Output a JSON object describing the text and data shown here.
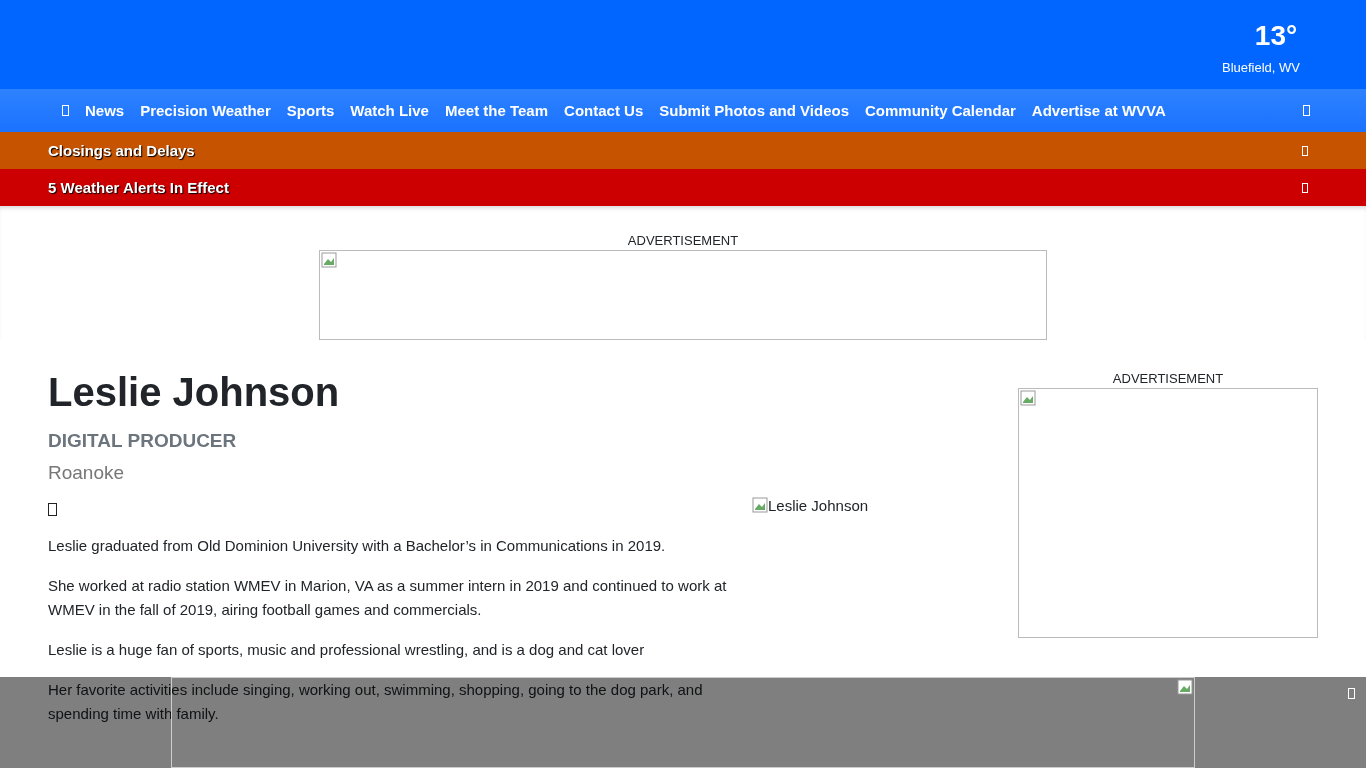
{
  "weather": {
    "temperature": "13°",
    "location": "Bluefield, WV"
  },
  "nav": {
    "items": [
      "News",
      "Precision Weather",
      "Sports",
      "Watch Live",
      "Meet the Team",
      "Contact Us",
      "Submit Photos and Videos",
      "Community Calendar",
      "Advertise at WVVA"
    ]
  },
  "banners": [
    {
      "text": "Closings and Delays",
      "color": "#c65300"
    },
    {
      "text": "5 Weather Alerts In Effect",
      "color": "#cc0000"
    }
  ],
  "top_ad": {
    "label": "ADVERTISEMENT"
  },
  "profile": {
    "name": "Leslie Johnson",
    "role": "DIGITAL PRODUCER",
    "location": "Roanoke",
    "photo_alt": "Leslie Johnson",
    "paragraphs": [
      "Leslie graduated from Old Dominion University with a Bachelor’s in Communications in 2019.",
      "She worked at radio station WMEV in Marion, VA as a summer intern in 2019 and continued to work at WMEV in the fall of 2019, airing football games and commercials.",
      "Leslie is a huge fan of sports, music and professional wrestling, and is a dog and cat lover",
      "Her favorite activities include singing, working out, swimming, shopping, going to the dog park, and spending time with family."
    ]
  },
  "side_ad": {
    "label": "ADVERTISEMENT"
  }
}
